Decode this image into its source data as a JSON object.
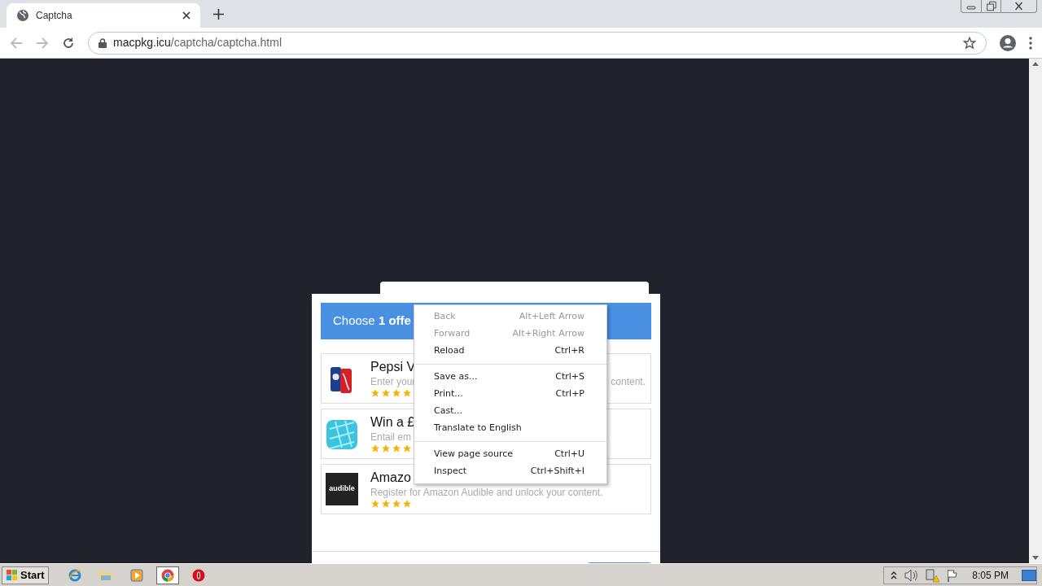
{
  "browser": {
    "tab": {
      "title": "Captcha",
      "selected": true
    },
    "url": {
      "host": "macpkg.icu",
      "path": "/captcha/captcha.html"
    },
    "back_disabled": true,
    "forward_disabled": true
  },
  "dialog": {
    "heading": "Choose **1 offe**",
    "offers": [
      {
        "kind": "cans",
        "title": "Pepsi V",
        "description": "Enter your",
        "description_tail": "content.",
        "stars": 4
      },
      {
        "kind": "tile",
        "title": "Win a £",
        "description": "Entail em",
        "stars": 4
      },
      {
        "kind": "logo",
        "logo_text": "audible",
        "title": "Amazo",
        "description": "Register for Amazon Audible and unlock your content.",
        "stars": 4
      }
    ]
  },
  "context_menu": [
    {
      "label": "Back",
      "shortcut": "Alt+Left Arrow",
      "disabled": true
    },
    {
      "label": "Forward",
      "shortcut": "Alt+Right Arrow",
      "disabled": true
    },
    {
      "label": "Reload",
      "shortcut": "Ctrl+R",
      "disabled": false
    },
    {
      "kind": "separator"
    },
    {
      "label": "Save as...",
      "shortcut": "Ctrl+S",
      "disabled": false
    },
    {
      "label": "Print...",
      "shortcut": "Ctrl+P",
      "disabled": false
    },
    {
      "label": "Cast...",
      "disabled": false
    },
    {
      "label": "Translate to English",
      "disabled": false
    },
    {
      "kind": "separator"
    },
    {
      "label": "View page source",
      "shortcut": "Ctrl+U",
      "disabled": false
    },
    {
      "label": "Inspect",
      "shortcut": "Ctrl+Shift+I",
      "disabled": false
    }
  ],
  "taskbar": {
    "start": "Start",
    "apps": [
      {
        "kind": "ie",
        "selected": false
      },
      {
        "kind": "folder",
        "selected": false
      },
      {
        "kind": "media",
        "selected": false
      },
      {
        "kind": "chrome",
        "selected": true
      },
      {
        "kind": "opera",
        "selected": false
      }
    ],
    "clock": "8:05 PM"
  }
}
